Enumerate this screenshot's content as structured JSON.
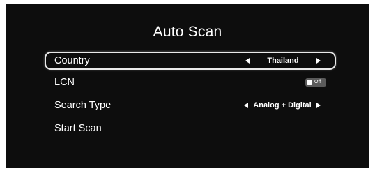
{
  "title": "Auto Scan",
  "menu": {
    "country": {
      "label": "Country",
      "value": "Thailand",
      "focused": true
    },
    "lcn": {
      "label": "LCN",
      "toggle_text": "Off",
      "toggle_state": "off"
    },
    "search_type": {
      "label": "Search Type",
      "value": "Analog + Digital"
    },
    "start_scan": {
      "label": "Start Scan"
    }
  },
  "icons": {
    "left": "left-triangle-icon",
    "right": "right-triangle-icon"
  },
  "colors": {
    "background": "#0d0d0d",
    "text": "#ffffff",
    "focus_border": "#e9e9e9",
    "toggle_off": "#5a5a5a"
  }
}
